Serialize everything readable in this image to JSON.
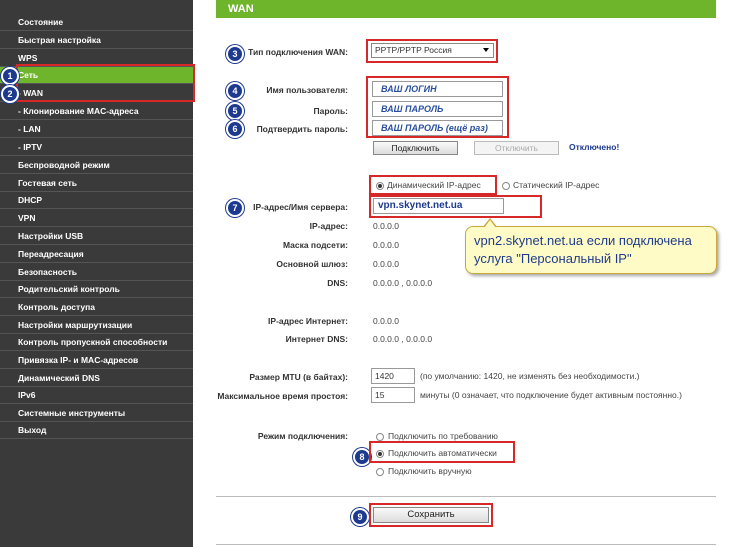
{
  "sidebar": {
    "items": [
      {
        "label": "Состояние"
      },
      {
        "label": "Быстрая настройка"
      },
      {
        "label": "WPS"
      },
      {
        "label": "Сеть"
      },
      {
        "label": "- WAN"
      },
      {
        "label": "- Клонирование MAC-адреса"
      },
      {
        "label": "- LAN"
      },
      {
        "label": "- IPTV"
      },
      {
        "label": "Беспроводной режим"
      },
      {
        "label": "Гостевая сеть"
      },
      {
        "label": "DHCP"
      },
      {
        "label": "VPN"
      },
      {
        "label": "Настройки USB"
      },
      {
        "label": "Переадресация"
      },
      {
        "label": "Безопасность"
      },
      {
        "label": "Родительский контроль"
      },
      {
        "label": "Контроль доступа"
      },
      {
        "label": "Настройки маршрутизации"
      },
      {
        "label": "Контроль пропускной способности"
      },
      {
        "label": "Привязка IP- и MAC-адресов"
      },
      {
        "label": "Динамический DNS"
      },
      {
        "label": "IPv6"
      },
      {
        "label": "Системные инструменты"
      },
      {
        "label": "Выход"
      }
    ]
  },
  "badges": [
    "1",
    "2",
    "3",
    "4",
    "5",
    "6",
    "7",
    "8",
    "9"
  ],
  "header": {
    "title": "WAN"
  },
  "connection_type": {
    "label": "Тип подключения WAN:",
    "value": "PPTP/PPTP Россия"
  },
  "username": {
    "label": "Имя пользователя:",
    "value": "ВАШ ЛОГИН"
  },
  "password": {
    "label": "Пароль:",
    "value": "ВАШ ПАРОЛЬ"
  },
  "confirm_password": {
    "label": "Подтвердить пароль:",
    "value": "ВАШ ПАРОЛЬ (ещё раз)"
  },
  "connect_button": "Подключить",
  "disconnect_button": "Отключить",
  "status": "Отключено!",
  "ip_mode": {
    "dynamic": "Динамический IP-адрес",
    "static": "Статический IP-адрес"
  },
  "server": {
    "label": "IP-адрес/Имя сервера:",
    "value": "vpn.skynet.net.ua"
  },
  "ip_address": {
    "label": "IP-адрес:",
    "value": "0.0.0.0"
  },
  "subnet_mask": {
    "label": "Маска подсети:",
    "value": "0.0.0.0"
  },
  "gateway": {
    "label": "Основной шлюз:",
    "value": "0.0.0.0"
  },
  "dns": {
    "label": "DNS:",
    "value": "0.0.0.0 , 0.0.0.0"
  },
  "internet_ip": {
    "label": "IP-адрес Интернет:",
    "value": "0.0.0.0"
  },
  "internet_dns": {
    "label": "Интернет DNS:",
    "value": "0.0.0.0 , 0.0.0.0"
  },
  "mtu": {
    "label": "Размер MTU (в байтах):",
    "value": "1420",
    "note": "(по умолчанию: 1420, не изменять без необходимости.)"
  },
  "idle": {
    "label": "Максимальное время простоя:",
    "value": "15",
    "note": "минуты (0 означает, что подключение будет активным постоянно.)"
  },
  "connection_mode": {
    "label": "Режим подключения:",
    "options": [
      "Подключить по требованию",
      "Подключить автоматически",
      "Подключить вручную"
    ],
    "selected": "Подключить автоматически"
  },
  "save_button": "Сохранить",
  "callout": {
    "text": "vpn2.skynet.net.ua если подключена услуга \"Персональный IP\""
  },
  "colors": {
    "accent_green": "#6fb52c",
    "sidebar": "#3a3a3a",
    "highlight_red": "#d62828",
    "badge_blue": "#1d3a8f"
  }
}
